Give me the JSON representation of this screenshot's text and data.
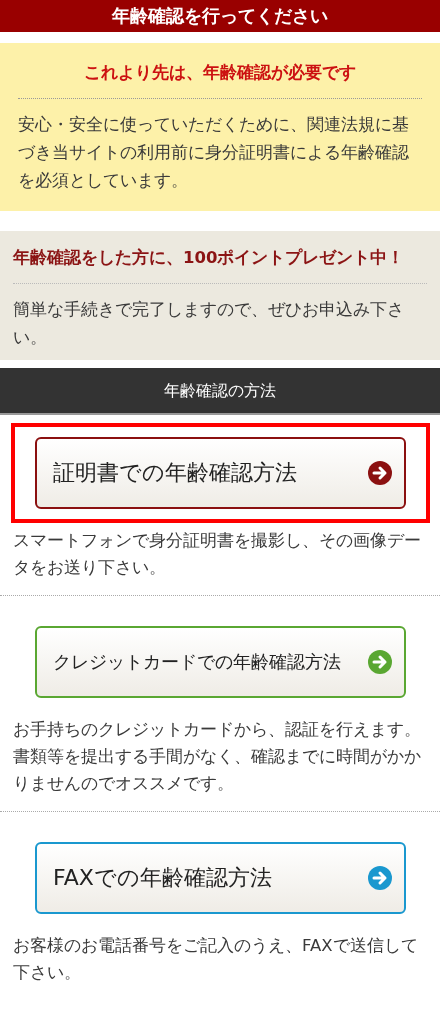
{
  "header": {
    "title": "年齢確認を行ってください"
  },
  "notice": {
    "title": "これより先は、年齢確認が必要です",
    "body": "安心・安全に使っていただくために、関連法規に基づき当サイトの利用前に身分証明書による年齢確認を必須としています。"
  },
  "campaign": {
    "title": "年齢確認をした方に、100ポイントプレゼント中！",
    "body": "簡単な手続きで完了しますので、ぜひお申込み下さい。"
  },
  "methods_section": {
    "title": "年齢確認の方法",
    "methods": [
      {
        "label": "証明書での年齢確認方法",
        "color": "#8b1010",
        "highlighted": true,
        "lines": [
          "スマートフォンで身分証明書を撮影し、その画像データをお送り下さい。"
        ]
      },
      {
        "label": "クレジットカードでの年齢確認方法",
        "color": "#5aa732",
        "highlighted": false,
        "lines": [
          "お手持ちのクレジットカードから、認証を行えます。",
          "書類等を提出する手間がなく、確認までに時間がかかりませんのでオススメです。"
        ]
      },
      {
        "label": "FAXでの年齢確認方法",
        "color": "#1a98cf",
        "highlighted": false,
        "lines": [
          "お客様のお電話番号をご記入のうえ、FAXで送信して下さい。"
        ]
      }
    ]
  }
}
